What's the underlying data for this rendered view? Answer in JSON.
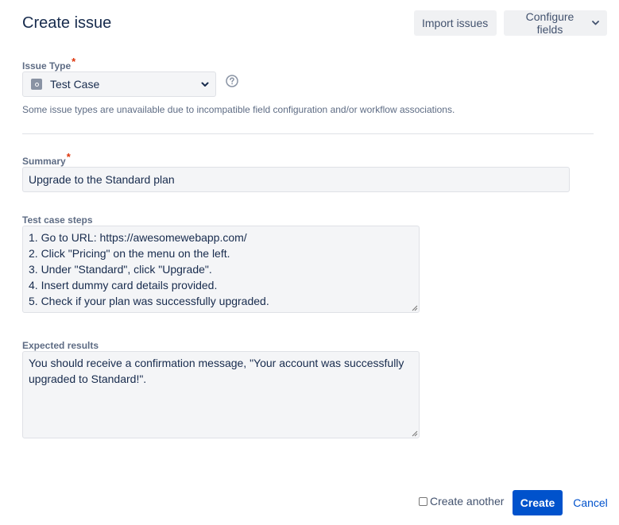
{
  "header": {
    "title": "Create issue",
    "import_label": "Import issues",
    "configure_label": "Configure fields"
  },
  "issue_type": {
    "label": "Issue Type",
    "required_mark": "*",
    "value": "Test Case",
    "icon": "test-case-icon",
    "note": "Some issue types are unavailable due to incompatible field configuration and/or workflow associations."
  },
  "summary": {
    "label": "Summary",
    "required_mark": "*",
    "value": "Upgrade to the Standard plan"
  },
  "steps": {
    "label": "Test case steps",
    "value": "1. Go to URL: https://awesomewebapp.com/\n2. Click \"Pricing\" on the menu on the left.\n3. Under \"Standard\", click \"Upgrade\".\n4. Insert dummy card details provided.\n5. Check if your plan was successfully upgraded."
  },
  "expected": {
    "label": "Expected results",
    "value": "You should receive a confirmation message, \"Your account was successfully upgraded to Standard!\"."
  },
  "footer": {
    "create_another_label": "Create another",
    "create_another_checked": false,
    "create_label": "Create",
    "cancel_label": "Cancel"
  },
  "colors": {
    "primary": "#0052cc",
    "required": "#de350b",
    "field_bg": "#f4f5f7",
    "text": "#172b4d"
  }
}
